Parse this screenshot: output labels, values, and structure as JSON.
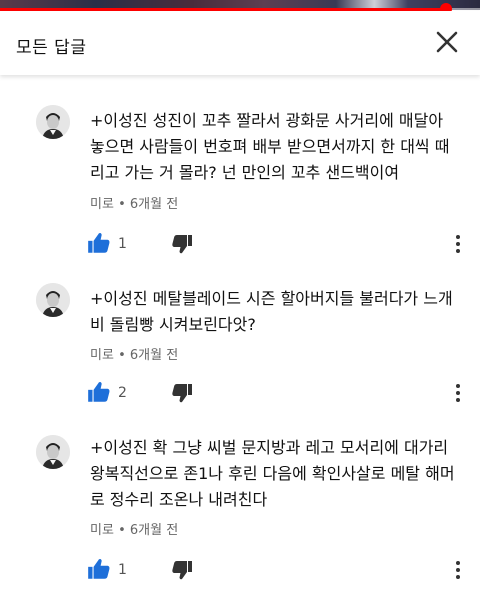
{
  "header": {
    "title": "모든 답글",
    "close_icon": "close-icon"
  },
  "video": {
    "progress_fraction": 0.93,
    "accent_color": "#ff0000"
  },
  "comments": [
    {
      "avatar_icon": "user-avatar",
      "text": "+이성진 성진이 꼬추 짤라서 광화문 사거리에 매달아 놓으면 사람들이 번호펴 배부 받으면서까지 한 대씩 때리고 가는 거 몰라? 넌 만인의 꼬추 샌드백이여",
      "author": "미로",
      "separator": "•",
      "time": "6개월 전",
      "likes": "1"
    },
    {
      "avatar_icon": "user-avatar",
      "text": "+이성진 메탈블레이드 시즌 할아버지들 불러다가 느개비 돌림빵 시켜보린다앗?",
      "author": "미로",
      "separator": "•",
      "time": "6개월 전",
      "likes": "2"
    },
    {
      "avatar_icon": "user-avatar",
      "text": "+이성진 확 그냥 씨벌 문지방과 레고 모서리에 대가리 왕복직선으로 존1나 후린 다음에 확인사살로 메탈 해머로 정수리 조온나 내려친다",
      "author": "미로",
      "separator": "•",
      "time": "6개월 전",
      "likes": "1"
    }
  ]
}
